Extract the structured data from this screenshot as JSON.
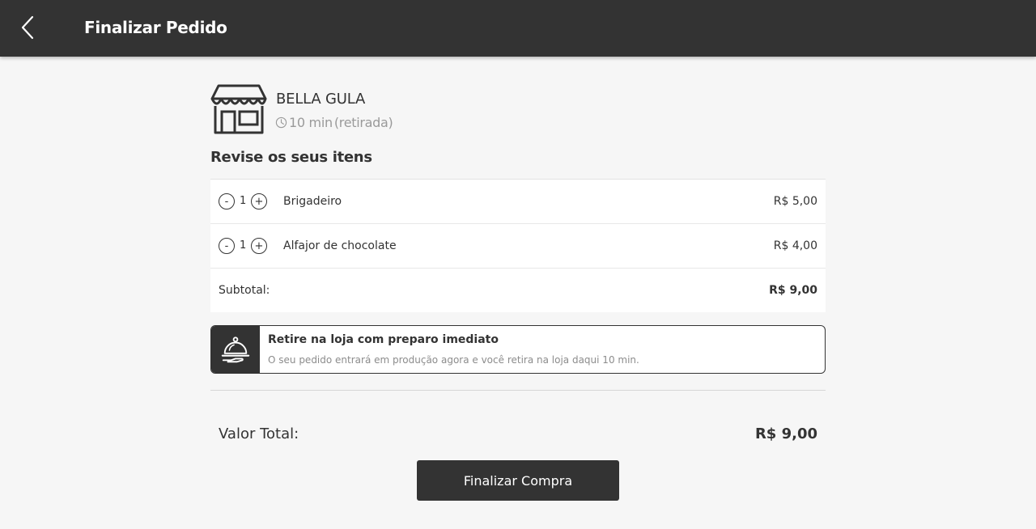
{
  "header": {
    "back_icon": "chevron-left-icon",
    "title": "Finalizar Pedido"
  },
  "store": {
    "icon": "storefront-icon",
    "name": "BELLA GULA",
    "time_icon": "clock-icon",
    "time": "10 min",
    "mode": "(retirada)"
  },
  "review": {
    "title": "Revise os seus itens",
    "items": [
      {
        "minus": "-",
        "qty": "1",
        "plus": "+",
        "name": "Brigadeiro",
        "price": "R$ 5,00"
      },
      {
        "minus": "-",
        "qty": "1",
        "plus": "+",
        "name": "Alfajor de chocolate",
        "price": "R$ 4,00"
      }
    ],
    "subtotal_label": "Subtotal:",
    "subtotal_value": "R$ 9,00"
  },
  "pickup": {
    "icon": "serving-cloche-icon",
    "title": "Retire na loja com preparo imediato",
    "description": "O seu pedido entrará em produção agora e você retira na loja daqui 10 min."
  },
  "total": {
    "label": "Valor Total:",
    "value": "R$ 9,00"
  },
  "actions": {
    "finish_label": "Finalizar Compra"
  },
  "colors": {
    "header_bg": "#333333",
    "page_bg": "#f6f6f6",
    "primary_button": "#333333",
    "muted_text": "#9a9a9a"
  }
}
